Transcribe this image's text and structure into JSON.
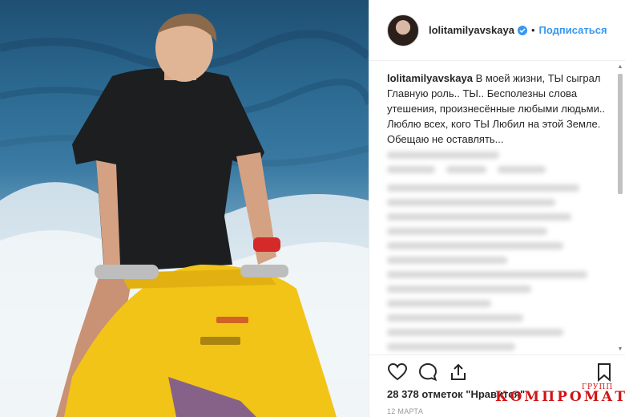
{
  "post": {
    "username": "lolitamilyavskaya",
    "dot": "•",
    "follow_label": "Подписаться",
    "caption_user": "lolitamilyavskaya",
    "caption_text": " В моей жизни, ТЫ сыграл Главную роль.. ТЫ.. Бесполезны слова утешения, произнесённые любыми людьми.. Люблю всех, кого ТЫ Любил на этой Земле. Обещаю не оставлять...",
    "likes": "28 378 отметок \"Нравится\"",
    "date": "12 МАРТА"
  },
  "icons": {
    "like": "heart-icon",
    "comment": "comment-icon",
    "share": "share-icon",
    "save": "bookmark-icon",
    "verified": "verified-badge-icon"
  },
  "colors": {
    "accent": "#3897f0",
    "watermark": "#d21414"
  },
  "watermark": {
    "small": "ГРУПП",
    "big": "КОМПРОМАТ"
  }
}
